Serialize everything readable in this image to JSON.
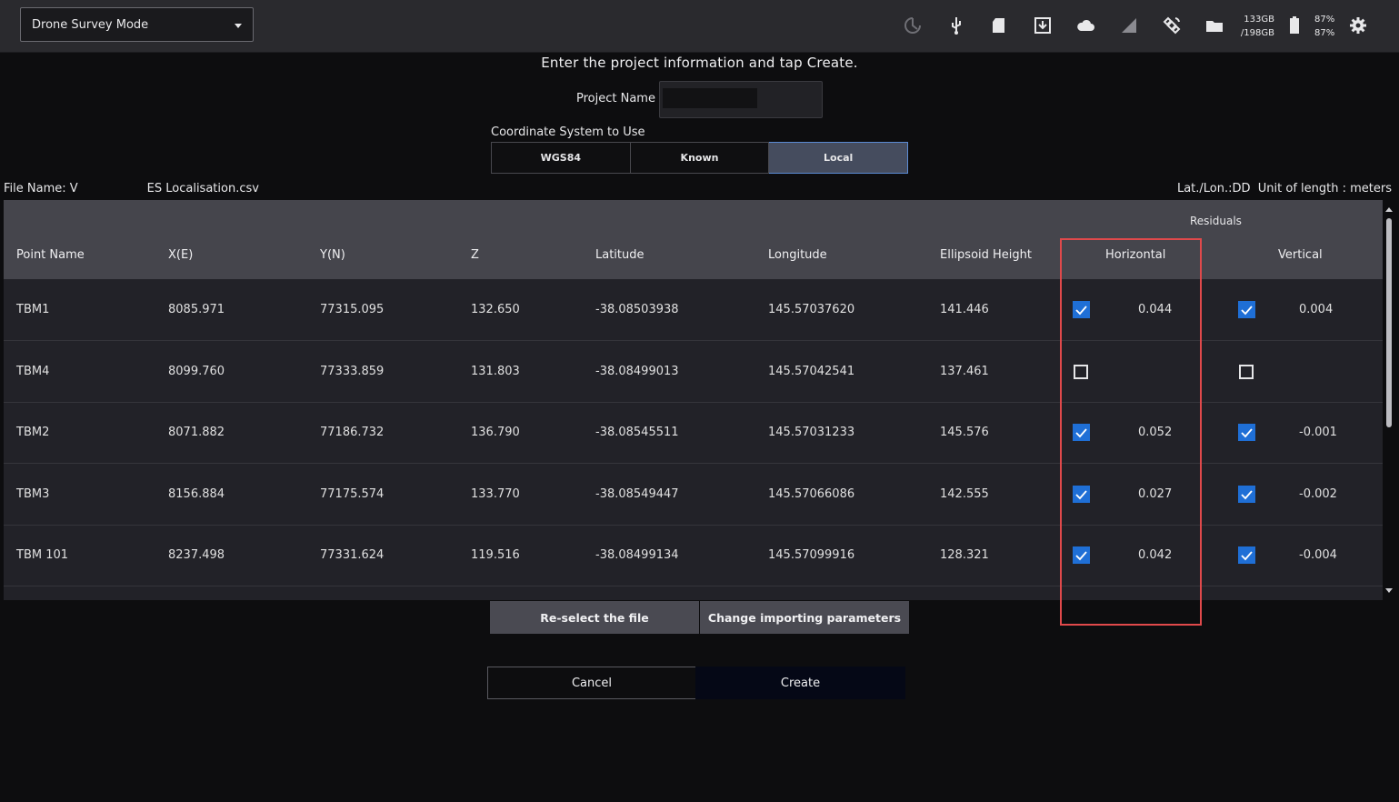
{
  "topbar": {
    "mode": "Drone Survey Mode",
    "storage_used": "133GB",
    "storage_total": "/198GB",
    "battery_top": "87%",
    "battery_bottom": "87%",
    "icons": [
      "sync-icon",
      "usb-icon",
      "sd-card-icon",
      "download-icon",
      "cloud-icon",
      "signal-icon",
      "satellite-icon",
      "folder-icon",
      "battery-icon",
      "gear-icon"
    ]
  },
  "form": {
    "instruction": "Enter the project information and tap Create.",
    "project_name_label": "Project Name",
    "project_name_value": "",
    "coord_label": "Coordinate System to Use",
    "coord_options": [
      "WGS84",
      "Known",
      "Local"
    ],
    "coord_selected": "Local"
  },
  "file": {
    "name_prefix": "File Name: V",
    "name_suffix": "ES Localisation.csv",
    "latlon_format": "Lat./Lon.:DD",
    "unit": "Unit of length : meters"
  },
  "table": {
    "group_header": "Residuals",
    "headers": [
      "Point Name",
      "X(E)",
      "Y(N)",
      "Z",
      "Latitude",
      "Longitude",
      "Ellipsoid Height",
      "Horizontal",
      "Vertical"
    ],
    "rows": [
      {
        "name": "TBM1",
        "x": "8085.971",
        "y": "77315.095",
        "z": "132.650",
        "lat": "-38.08503938",
        "lon": "145.57037620",
        "h": "141.446",
        "hz_on": true,
        "hz": "0.044",
        "v_on": true,
        "v": "0.004"
      },
      {
        "name": "TBM4",
        "x": "8099.760",
        "y": "77333.859",
        "z": "131.803",
        "lat": "-38.08499013",
        "lon": "145.57042541",
        "h": "137.461",
        "hz_on": false,
        "hz": "",
        "v_on": false,
        "v": ""
      },
      {
        "name": "TBM2",
        "x": "8071.882",
        "y": "77186.732",
        "z": "136.790",
        "lat": "-38.08545511",
        "lon": "145.57031233",
        "h": "145.576",
        "hz_on": true,
        "hz": "0.052",
        "v_on": true,
        "v": "-0.001"
      },
      {
        "name": "TBM3",
        "x": "8156.884",
        "y": "77175.574",
        "z": "133.770",
        "lat": "-38.08549447",
        "lon": "145.57066086",
        "h": "142.555",
        "hz_on": true,
        "hz": "0.027",
        "v_on": true,
        "v": "-0.002"
      },
      {
        "name": "TBM 101",
        "x": "8237.498",
        "y": "77331.624",
        "z": "119.516",
        "lat": "-38.08499134",
        "lon": "145.57099916",
        "h": "128.321",
        "hz_on": true,
        "hz": "0.042",
        "v_on": true,
        "v": "-0.004"
      }
    ]
  },
  "buttons": {
    "reselect": "Re-select the file",
    "change_params": "Change importing parameters",
    "cancel": "Cancel",
    "create": "Create"
  },
  "colors": {
    "accent": "#1f6fd6",
    "highlight": "#e0494b",
    "header_bg": "#45454c",
    "row_bg": "#222228"
  }
}
